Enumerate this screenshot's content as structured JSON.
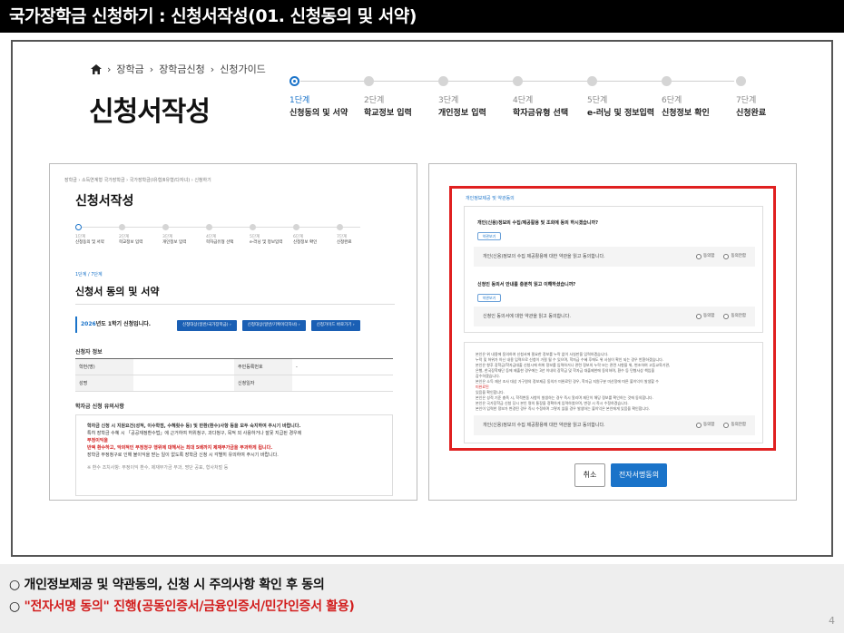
{
  "title": "국가장학금 신청하기 : 신청서작성(01. 신청동의 및 서약)",
  "breadcrumb": [
    "장학금",
    "장학금신청",
    "신청가이드"
  ],
  "page_title": "신청서작성",
  "steps": [
    {
      "num": "1단계",
      "label": "신청동의 및 서약"
    },
    {
      "num": "2단계",
      "label": "학교정보 입력"
    },
    {
      "num": "3단계",
      "label": "개인정보 입력"
    },
    {
      "num": "4단계",
      "label": "학자금유형 선택"
    },
    {
      "num": "5단계",
      "label": "e-러닝 및 정보입력"
    },
    {
      "num": "6단계",
      "label": "신청정보 확인"
    },
    {
      "num": "7단계",
      "label": "신청완료"
    }
  ],
  "left_shot": {
    "breadcrumb": "장학금 › 소득연계형 국가장학금 › 국가장학금(Ⅰ유형/Ⅱ유형/다자녀) › 신청하기",
    "title": "신청서작성",
    "substep": "1단계 / 7단계",
    "heading": "신청서 동의 및 서약",
    "apply_year": "2026",
    "apply_text": "년도 1학기 신청입니다.",
    "buttons": [
      "신청대상(일반/국가장학금) ›",
      "신청대상(일반/기획이다자녀) ›",
      "신청가이드 바로가기 ›"
    ],
    "applicant_section": "신청자 정보",
    "table": {
      "rows": [
        [
          "학번(명)",
          "",
          "주민등록번호",
          "-"
        ],
        [
          "성명",
          "",
          "신청일자",
          ""
        ]
      ]
    },
    "notice_section": "학자금 신청 유의사항",
    "notice_lines": [
      "학자금 신청 시 지원요건(성적, 이수학점, 수혜횟수 등) 및 반환(환수)사항 등을 모두 숙지하여 주시기 바랍니다.",
      "특히 장학금 수혜 시 「공공재정환수법」에 근거하여 허위청구, 과다청구, 목적 외 사용하거나 잘못 지급된 경우에",
      "반액 환수하고, 악의적인 부정청구 행위에 대해서는 최대 5배까지 제재부가금을 부과하게 됩니다.",
      "장학금 부정청구로 인해 불이익을 받는 일이 없도록 장학금 신청 시 각별히 유의하여 주시기 바랍니다."
    ],
    "notice_red": "부정이익을",
    "notice_footer": "※ 환수 조치사항: 부정이익 환수, 제재부가금 부과, 명단 공표, 형사처벌 등"
  },
  "right_shot": {
    "section_title": "개인정보제공 및 약관동의",
    "q1": "개인(신용)정보의 수집/제공활용 및 조회에 동의 하시겠습니까?",
    "q2": "신청인 동의서 안내를 충분히 읽고 이해하셨습니까?",
    "pill": "약관보기",
    "agree1": "개인(신용)정보의 수집 제공활용에 대한 약관을 읽고 동의합니다.",
    "agree2": "신청인 동의서에 대한 약관을 읽고 동의합니다.",
    "agree3": "개인(신용)정보의 수집 제공활용에 대한 약관을 읽고 동의합니다.",
    "radio_agree": "동의함",
    "radio_disagree": "동의안함",
    "terms": [
      "본인은 위 내용에 동의하여 신청서에 필요한 정보를 누락 없이 사실만을 입력하겠습니다.",
      "누락 및 허위가 아닌 내용 입력으로 신청이 거절 될 수 있으며, 학자금 수혜 후에도 위 사실이 확인 되는 경우 반환하겠습니다.",
      "본인은 향후 장학금/학자금대출 신청시에 허위 정보를 입력하거나 관련 정보의 누락 또는 관련 사항을 위, 변조하여 고등교육기관,",
      "은행, 한국장학재단 등에 제출한 경우에는 3년 이내의 장학금 및 학자금 대출제한에 동의하며, 환수 등 민형사상 책임을",
      "감수하겠습니다.",
      "본인은 소득 재산 조사 대상 가구원의 정보제공 동의가 미완료된 경우, 학자금 지원구분 미산정에 따른 불이익이 발생할 수",
      "있음을 확인합니다.",
      "본인은 성적 기준 충족 시, 학적변동 사항이 발생하는 경우 즉시 알리며 재단이 해당 정보를 확인하는 것에 동의합니다.",
      "본인은 국가장학금 신청 당시 본인 명의 통장을 정확하게 입력하였으며, 변경 시 즉시 수정하겠습니다.",
      "본인이 입력한 정보가 변경된 경우 즉시 수정하며 그렇지 않을 경우 발생하는 불이익은 본인에게 있음을 확인합니다."
    ],
    "terms_red": "미완료된",
    "cancel": "취소",
    "sign": "전자서명동의"
  },
  "bottom": {
    "line1": "○ 개인정보제공 및 약관동의, 신청 시 주의사항 확인 후 동의",
    "line2_prefix": "○ ",
    "line2_red": "\"전자서명 동의\" 진행(공동인증서/금융인증서/민간인증서 활용)"
  },
  "page_number": "4"
}
